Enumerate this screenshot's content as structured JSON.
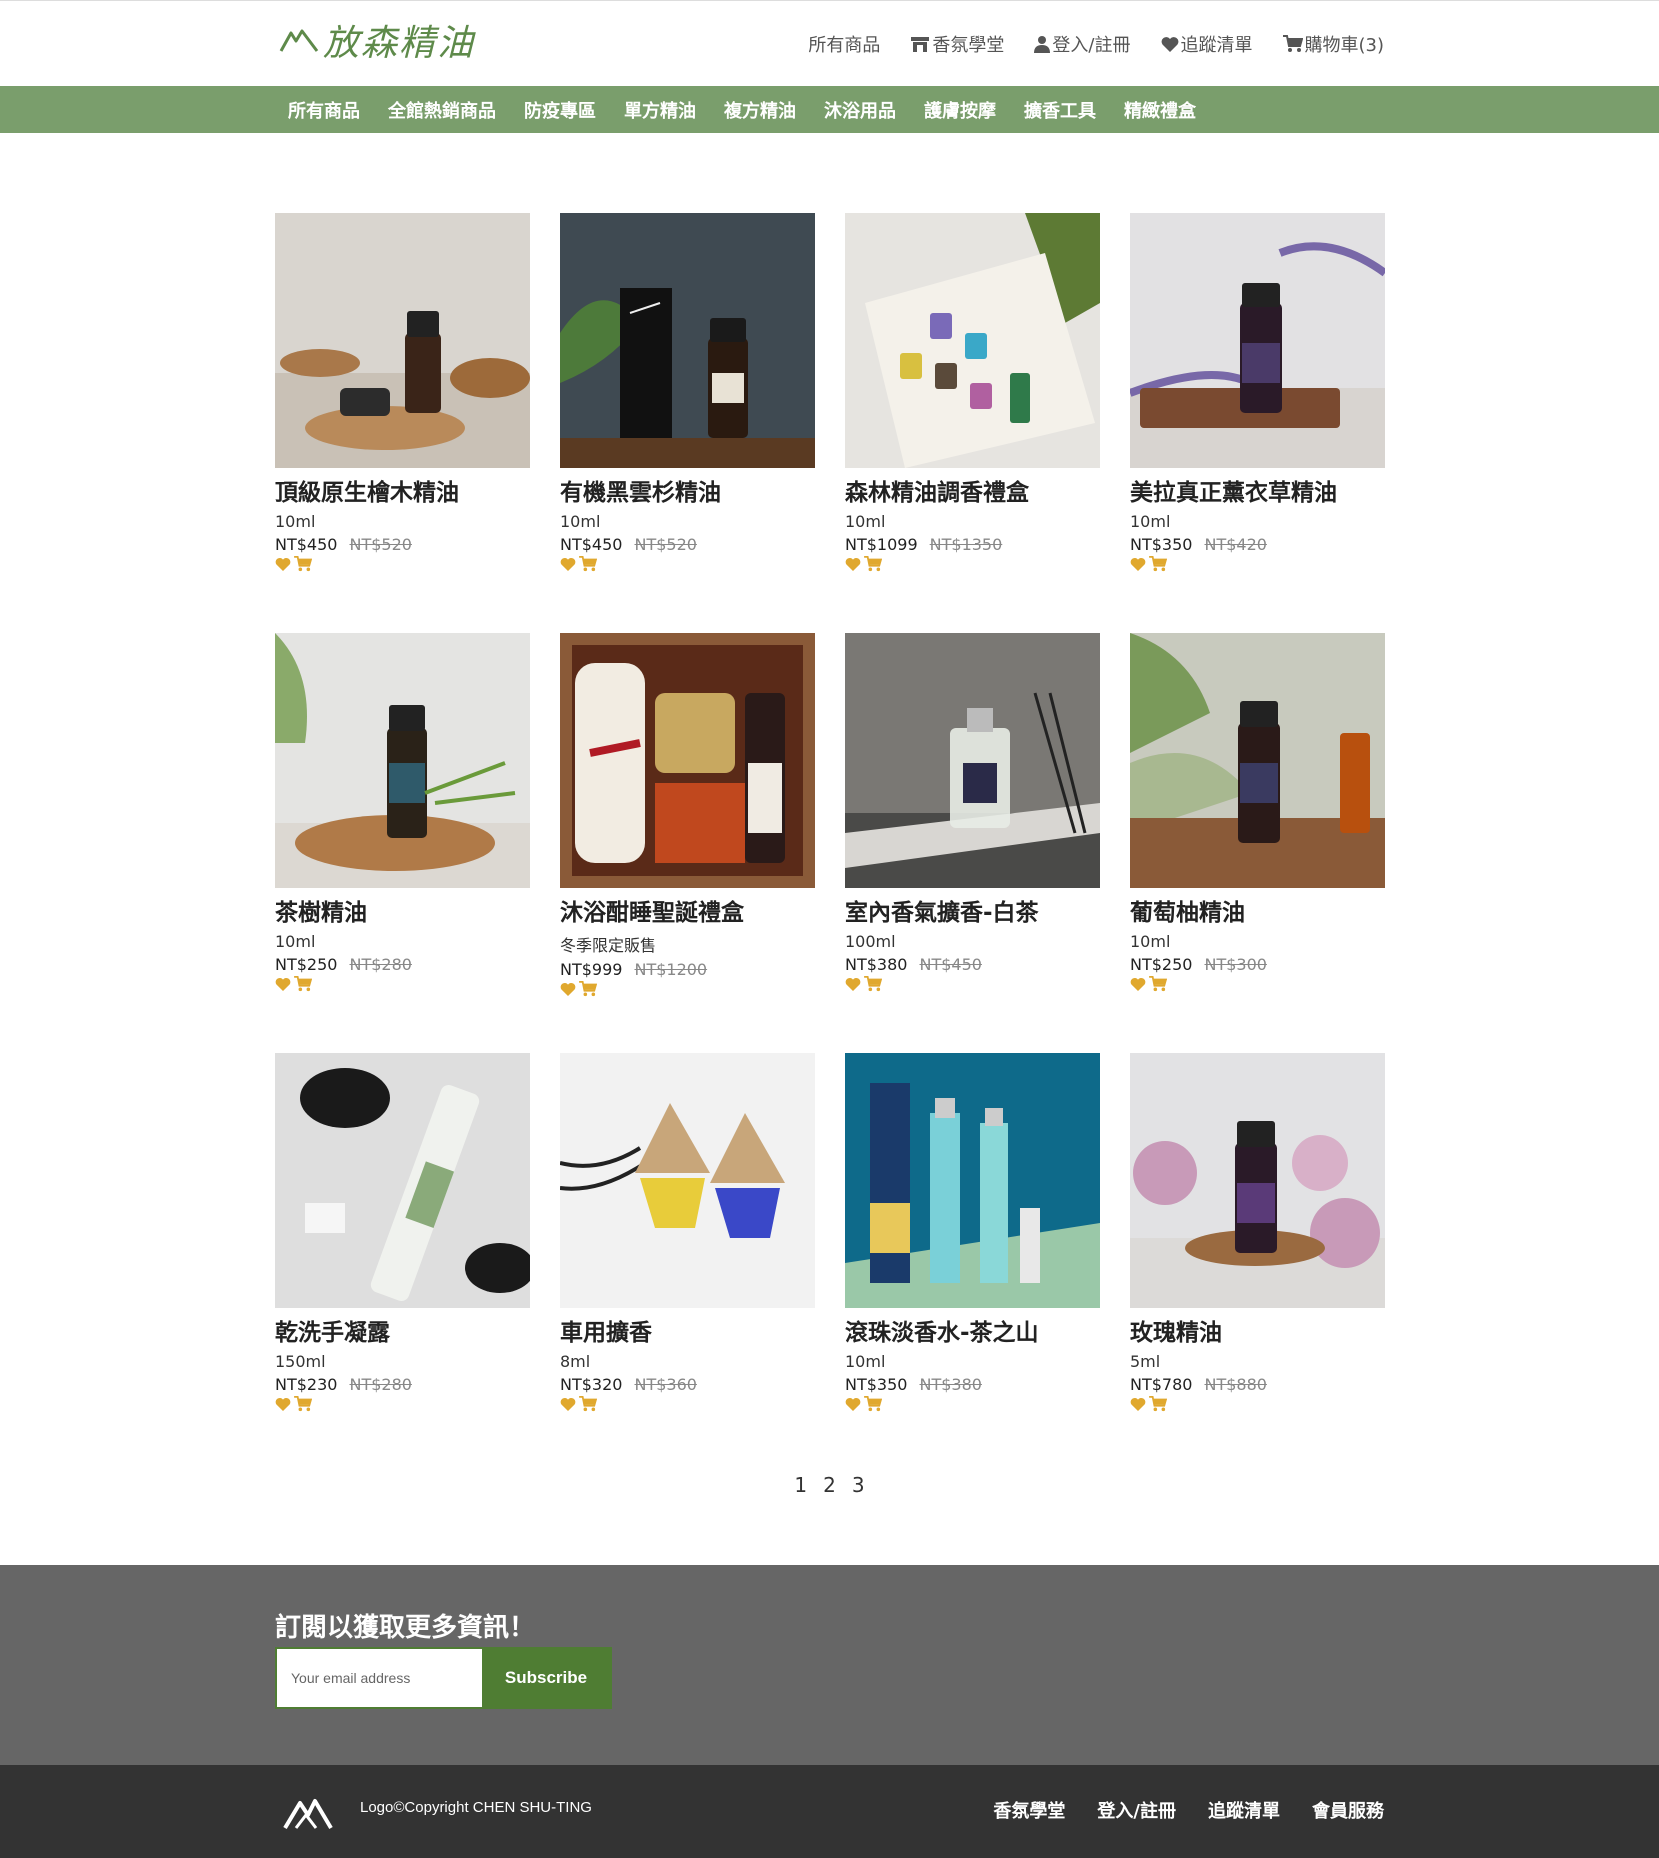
{
  "header": {
    "logo_text": "放森精油",
    "nav": [
      {
        "label": "所有商品",
        "icon": ""
      },
      {
        "label": "香氛學堂",
        "icon": "store-icon"
      },
      {
        "label": "登入/註冊",
        "icon": "user-icon"
      },
      {
        "label": "追蹤清單",
        "icon": "heart-icon"
      },
      {
        "label": "購物車(3)",
        "icon": "cart-icon"
      }
    ]
  },
  "categories": [
    "所有商品",
    "全館熱銷商品",
    "防疫專區",
    "單方精油",
    "複方精油",
    "沐浴用品",
    "護膚按摩",
    "擴香工具",
    "精緻禮盒"
  ],
  "products": [
    {
      "name": "頂級原生檜木精油",
      "volume": "10ml",
      "price": "NT$450",
      "old_price": "NT$520"
    },
    {
      "name": "有機黑雲杉精油",
      "volume": "10ml",
      "price": "NT$450",
      "old_price": "NT$520"
    },
    {
      "name": "森林精油調香禮盒",
      "volume": "10ml",
      "price": "NT$1099",
      "old_price": "NT$1350"
    },
    {
      "name": "美拉真正薰衣草精油",
      "volume": "10ml",
      "price": "NT$350",
      "old_price": "NT$420"
    },
    {
      "name": "茶樹精油",
      "volume": "10ml",
      "price": "NT$250",
      "old_price": "NT$280"
    },
    {
      "name": "沐浴酣睡聖誕禮盒",
      "volume": "冬季限定販售",
      "price": "NT$999",
      "old_price": "NT$1200"
    },
    {
      "name": "室內香氣擴香-白茶",
      "volume": "100ml",
      "price": "NT$380",
      "old_price": "NT$450"
    },
    {
      "name": "葡萄柚精油",
      "volume": "10ml",
      "price": "NT$250",
      "old_price": "NT$300"
    },
    {
      "name": "乾洗手凝露",
      "volume": "150ml",
      "price": "NT$230",
      "old_price": "NT$280"
    },
    {
      "name": "車用擴香",
      "volume": "8ml",
      "price": "NT$320",
      "old_price": "NT$360"
    },
    {
      "name": "滾珠淡香水-茶之山",
      "volume": "10ml",
      "price": "NT$350",
      "old_price": "NT$380"
    },
    {
      "name": "玫瑰精油",
      "volume": "5ml",
      "price": "NT$780",
      "old_price": "NT$880"
    }
  ],
  "pagination": [
    "1",
    "2",
    "3"
  ],
  "subscribe": {
    "title": "訂閱以獲取更多資訊！",
    "placeholder": "Your email address",
    "button": "Subscribe"
  },
  "footer": {
    "copyright": "Logo©Copyright CHEN SHU-TING",
    "links": [
      "香氛學堂",
      "登入/註冊",
      "追蹤清單",
      "會員服務"
    ]
  },
  "colors": {
    "brand_green": "#7a9e6c",
    "button_green": "#4f7d33",
    "icon_gold": "#e0a82e",
    "subscribe_bg": "#666666",
    "footer_bg": "#333333"
  }
}
